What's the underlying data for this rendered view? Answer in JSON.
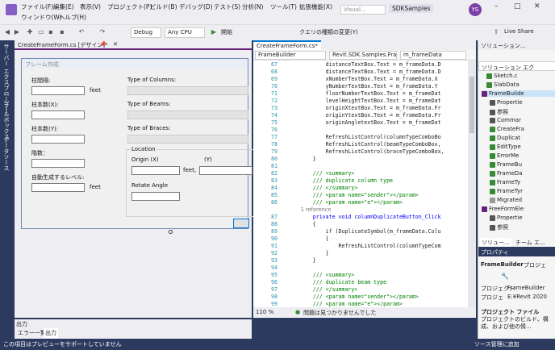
{
  "menu": {
    "row1": [
      "ファイル(F)",
      "編集(E)",
      "表示(V)",
      "プロジェクト(P)",
      "ビルド(B)",
      "デバッグ(D)",
      "テスト(S)",
      "分析(N)",
      "ツール(T)",
      "拡張機能(X)"
    ],
    "row2": [
      "ウィンドウ(W)",
      "ヘルプ(H)"
    ],
    "search_placeholder": "Visual...",
    "solution_name": "SDKSamples",
    "avatar_initials": "YS",
    "live_share": "Live Share"
  },
  "toolbar": {
    "config": "Debug",
    "platform": "Any CPU",
    "start": "開始",
    "query": "クエリの種類の変更(Y)"
  },
  "left_tabs": [
    "サーバー エクスプローラー",
    "ツールボックス",
    "データソース"
  ],
  "designer": {
    "tab": "CreateFrameForm.cs [デザイン]*",
    "form_title": "フレーム作成",
    "labels": {
      "distance": "柱間隔:",
      "col_x": "柱本数(X):",
      "col_y": "柱本数(Y):",
      "floors": "階数：",
      "level": "自動生成するレベル:",
      "feet1": "feet",
      "feet2": "feet",
      "feet3": "feet,",
      "type_columns": "Type of Columns:",
      "type_beams": "Type of Beams:",
      "type_braces": "Type of Braces:",
      "location": "Location",
      "origin_x": "Origin (X)",
      "origin_y": "(Y)",
      "rotate": "Rotate Angle"
    }
  },
  "output": {
    "title": "出力",
    "tabs": [
      "エラー一覧",
      "出力"
    ]
  },
  "status_bar": {
    "left": "この項目はプレビューをサポートしていません",
    "right": "ソース管理に追加"
  },
  "editor": {
    "tab": "CreateFrameForm.cs*",
    "nav": [
      "FrameBuilder",
      "Revit.SDK.Samples.Fra",
      "m_frameData"
    ],
    "zoom": "110 %",
    "issues": "問題は見つかりませんでした",
    "lines": [
      {
        "n": "67",
        "t": "            distanceTextBox.Text = m_frameData.D"
      },
      {
        "n": "68",
        "t": "            distanceTextBox.Text = m_frameData.D"
      },
      {
        "n": "69",
        "t": "            xNumberTextBox.Text = m_frameData.X"
      },
      {
        "n": "70",
        "t": "            yNumberTextBox.Text = m_frameData.Y"
      },
      {
        "n": "71",
        "t": "            floorNumberTextBox.Text = m_frameDat"
      },
      {
        "n": "72",
        "t": "            levelHeightTextBox.Text = m_frameDat"
      },
      {
        "n": "73",
        "t": "            originXtextBox.Text = m_frameData.Fr"
      },
      {
        "n": "74",
        "t": "            originYtextBox.Text = m_frameData.Fr"
      },
      {
        "n": "75",
        "t": "            originAngletextBox.Text = m_frameDat"
      },
      {
        "n": "76",
        "t": ""
      },
      {
        "n": "77",
        "t": "            RefreshListControl(columnTypeComboBo"
      },
      {
        "n": "78",
        "t": "            RefreshListControl(beamTypeComboBox,"
      },
      {
        "n": "79",
        "t": "            RefreshListControl(braceTypeComboBox,"
      },
      {
        "n": "80",
        "t": "        }"
      },
      {
        "n": "81",
        "t": ""
      },
      {
        "n": "82",
        "t": "        /// <summary>"
      },
      {
        "n": "83",
        "t": "        /// duplicate column type"
      },
      {
        "n": "84",
        "t": "        /// </summary>"
      },
      {
        "n": "85",
        "t": "        /// <param name=\"sender\"></param>"
      },
      {
        "n": "86",
        "t": "        /// <param name=\"e\"></param>"
      },
      {
        "n": "",
        "t": "        1 reference"
      },
      {
        "n": "87",
        "t": "        private void columnDuplicateButton_Click"
      },
      {
        "n": "88",
        "t": "        {"
      },
      {
        "n": "89",
        "t": "            if (DuplicateSymbol(m_frameData.Colu"
      },
      {
        "n": "90",
        "t": "            {"
      },
      {
        "n": "91",
        "t": "                RefreshListControl(columnTypeCom"
      },
      {
        "n": "92",
        "t": "            }"
      },
      {
        "n": "93",
        "t": "        }"
      },
      {
        "n": "94",
        "t": ""
      },
      {
        "n": "95",
        "t": "        /// <summary>"
      },
      {
        "n": "96",
        "t": "        /// duplicate beam type"
      },
      {
        "n": "97",
        "t": "        /// </summary>"
      },
      {
        "n": "98",
        "t": "        /// <param name=\"sender\"></param>"
      },
      {
        "n": "99",
        "t": "        /// <param name=\"e\"></param>"
      }
    ]
  },
  "solution": {
    "header": "ソリューション...",
    "search": "ソリューション エク",
    "items": [
      "Sketch.c",
      "SlabData",
      "FrameBuilde",
      "Propertie",
      "参照",
      "Commar",
      "CreateFra",
      "Duplicat",
      "EditType",
      "ErrorMe",
      "FrameBu",
      "FrameDa",
      "FrameTy",
      "FrameTyr",
      "Migrated",
      "FreeFormEle",
      "Propertie",
      "参照"
    ],
    "tabs": [
      "ソリュー...",
      "チーム エ..."
    ]
  },
  "properties": {
    "header": "プロパティ",
    "object": "FrameBuilder",
    "object_kind": "プロジェ",
    "rows": [
      {
        "k": "プロジェクト",
        "v": "FrameBuilder"
      },
      {
        "k": "プロジェ",
        "v": "E:¥Revit 2020"
      }
    ],
    "desc_title": "プロジェクト ファイル",
    "desc": "プロジェクトのビルド、構成、および他の情..."
  },
  "colors": {
    "accent": "#2d3a5f",
    "form_border": "#6a8bb7",
    "comment": "#008000",
    "keyword": "#0000ff",
    "type": "#2b91af"
  }
}
